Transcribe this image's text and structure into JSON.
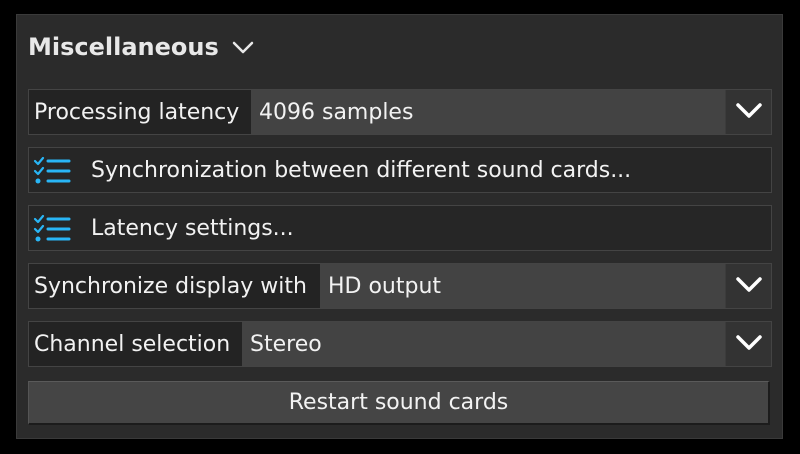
{
  "section": {
    "title": "Miscellaneous",
    "toggle_icon": "chevron-down-icon"
  },
  "processing_latency": {
    "label": "Processing latency",
    "value": "4096 samples",
    "dropdown_icon": "chevron-down-icon"
  },
  "sync_sound_cards": {
    "label": "Synchronization between different sound cards...",
    "icon": "checklist-icon"
  },
  "latency_settings": {
    "label": "Latency settings...",
    "icon": "checklist-icon"
  },
  "sync_display": {
    "label": "Synchronize display with",
    "value": "HD output",
    "dropdown_icon": "chevron-down-icon"
  },
  "channel_selection": {
    "label": "Channel selection",
    "value": "Stereo",
    "dropdown_icon": "chevron-down-icon"
  },
  "restart_button": {
    "label": "Restart sound cards"
  },
  "colors": {
    "accent_icon": "#29b6f6",
    "panel_bg": "#2b2b2b",
    "value_bg": "#434343",
    "button_bg": "#454545"
  }
}
